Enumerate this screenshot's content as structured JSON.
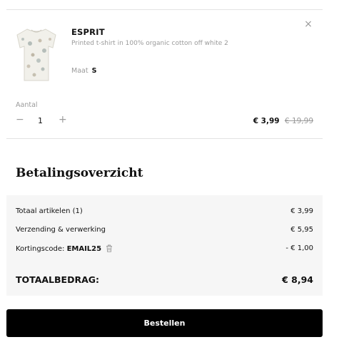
{
  "cart_item": {
    "brand": "ESPRIT",
    "description": "Printed t-shirt in 100% organic cotton off white 2",
    "size_label": "Maat",
    "size_value": "S",
    "close_icon": "close-icon",
    "quantity_label": "Aantal",
    "quantity": "1",
    "decrease_icon": "minus-icon",
    "increase_icon": "plus-icon",
    "price": "€ 3,99",
    "original_price": "€ 19,99"
  },
  "summary": {
    "title": "Betalingsoverzicht",
    "rows": [
      {
        "label": "Totaal artikelen (1)",
        "value": "€ 3,99"
      },
      {
        "label": "Verzending & verwerking",
        "value": "€ 5,95"
      }
    ],
    "discount": {
      "label": "Kortingscode:",
      "code": "EMAIL25",
      "icon": "trash-icon",
      "value": "- € 1,00"
    },
    "total": {
      "label": "TOTAALBEDRAG:",
      "value": "€ 8,94"
    }
  },
  "checkout": {
    "button_label": "Bestellen"
  },
  "colors": {
    "button_background": "#000000",
    "summary_background": "#f6f6f6",
    "muted_text": "#9a9a9a"
  }
}
